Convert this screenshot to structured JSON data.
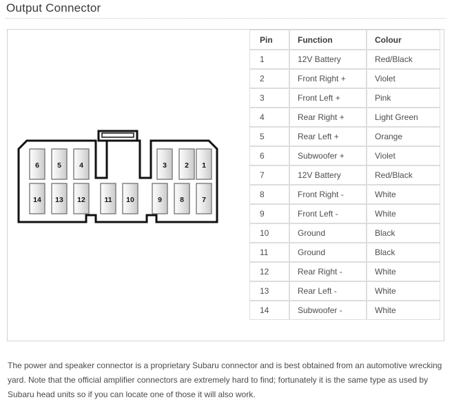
{
  "page": {
    "title": "Output Connector"
  },
  "table": {
    "headers": [
      "Pin",
      "Function",
      "Colour"
    ],
    "rows": [
      {
        "pin": "1",
        "function": "12V Battery",
        "colour": "Red/Black"
      },
      {
        "pin": "2",
        "function": "Front Right +",
        "colour": "Violet"
      },
      {
        "pin": "3",
        "function": "Front Left +",
        "colour": "Pink"
      },
      {
        "pin": "4",
        "function": "Rear Right +",
        "colour": "Light Green"
      },
      {
        "pin": "5",
        "function": "Rear Left +",
        "colour": "Orange"
      },
      {
        "pin": "6",
        "function": "Subwoofer +",
        "colour": "Violet"
      },
      {
        "pin": "7",
        "function": "12V Battery",
        "colour": "Red/Black"
      },
      {
        "pin": "8",
        "function": "Front Right -",
        "colour": "White"
      },
      {
        "pin": "9",
        "function": "Front Left -",
        "colour": "White"
      },
      {
        "pin": "10",
        "function": "Ground",
        "colour": "Black"
      },
      {
        "pin": "11",
        "function": "Ground",
        "colour": "Black"
      },
      {
        "pin": "12",
        "function": "Rear Right -",
        "colour": "White"
      },
      {
        "pin": "13",
        "function": "Rear Left -",
        "colour": "White"
      },
      {
        "pin": "14",
        "function": "Subwoofer -",
        "colour": "White"
      }
    ]
  },
  "connector": {
    "top_row_pins": [
      "6",
      "5",
      "4",
      "3",
      "2",
      "1"
    ],
    "bottom_row_pins": [
      "14",
      "13",
      "12",
      "11",
      "10",
      "9",
      "8",
      "7"
    ]
  },
  "footer": {
    "note": "The power and speaker connector is a proprietary Subaru connector and is best obtained from an automotive wrecking yard. Note that the official amplifier connectors are extremely hard to find; fortunately it is the same type as used by Subaru head units so if you can locate one of those it will also work."
  },
  "colors": {
    "border": "#d2d2d2",
    "table_border": "#dddddd",
    "text": "#4d4d4d",
    "outline": "#111111"
  }
}
